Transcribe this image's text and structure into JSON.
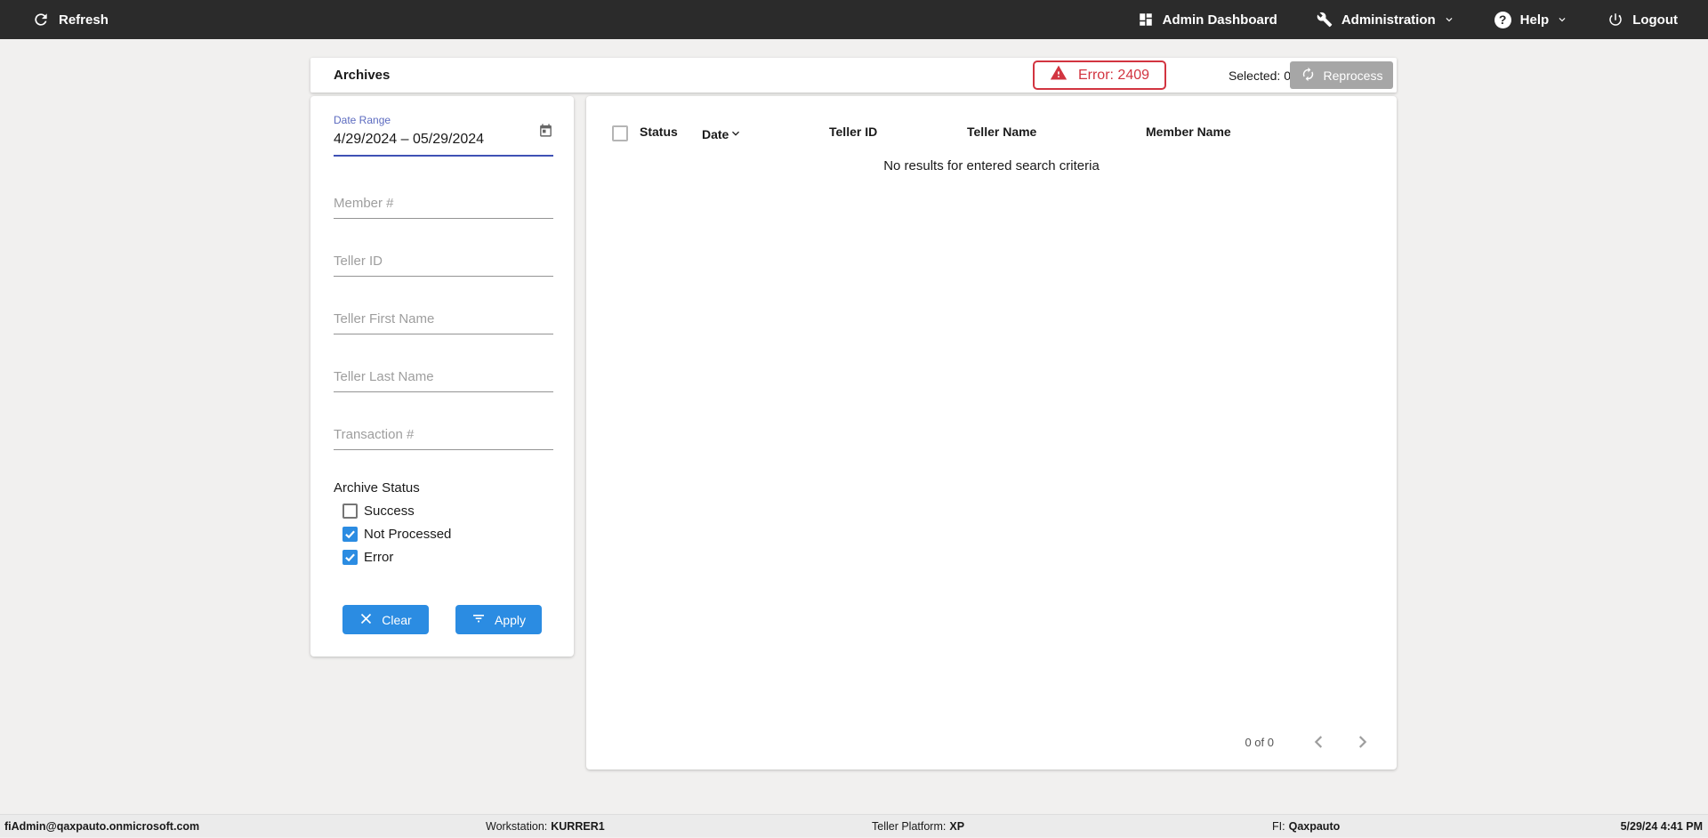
{
  "topnav": {
    "refresh_label": "Refresh",
    "admin_dashboard_label": "Admin Dashboard",
    "administration_label": "Administration",
    "help_label": "Help",
    "help_icon_glyph": "?",
    "logout_label": "Logout"
  },
  "header": {
    "title": "Archives",
    "error_badge_label": "Error: 2409",
    "selected_label": "Selected: 0",
    "reprocess_label": "Reprocess"
  },
  "filters": {
    "date_range": {
      "label": "Date Range",
      "value": "4/29/2024 – 05/29/2024"
    },
    "member_number": {
      "placeholder": "Member #"
    },
    "teller_id": {
      "placeholder": "Teller ID"
    },
    "teller_first_name": {
      "placeholder": "Teller First Name"
    },
    "teller_last_name": {
      "placeholder": "Teller Last Name"
    },
    "transaction_number": {
      "placeholder": "Transaction #"
    },
    "archive_status_label": "Archive Status",
    "checkboxes": [
      {
        "label": "Success",
        "checked": false
      },
      {
        "label": "Not Processed",
        "checked": true
      },
      {
        "label": "Error",
        "checked": true
      }
    ],
    "clear_label": "Clear",
    "apply_label": "Apply"
  },
  "table": {
    "columns": [
      "Status",
      "Date",
      "Teller ID",
      "Teller Name",
      "Member Name"
    ],
    "sorted_column": "Date",
    "empty_message": "No results for entered search criteria",
    "pagination_count": "0 of 0"
  },
  "statusbar": {
    "user": "fiAdmin@qaxpauto.onmicrosoft.com",
    "workstation_label": "Workstation:",
    "workstation_value": "KURRER1",
    "teller_platform_label": "Teller Platform:",
    "teller_platform_value": "XP",
    "fi_label": "FI:",
    "fi_value": "Qaxpauto",
    "datetime": "5/29/24 4:41 PM"
  },
  "colors": {
    "topnav_bg": "#2b2b2b",
    "accent_blue": "#2b8ce2",
    "focus_indigo": "#3f51b5",
    "label_indigo": "#5c6bc0",
    "error_red": "#d23440",
    "disabled_gray": "#a6a6a6",
    "page_bg": "#f1f0ef",
    "statusbar_bg": "#ebebeb"
  }
}
